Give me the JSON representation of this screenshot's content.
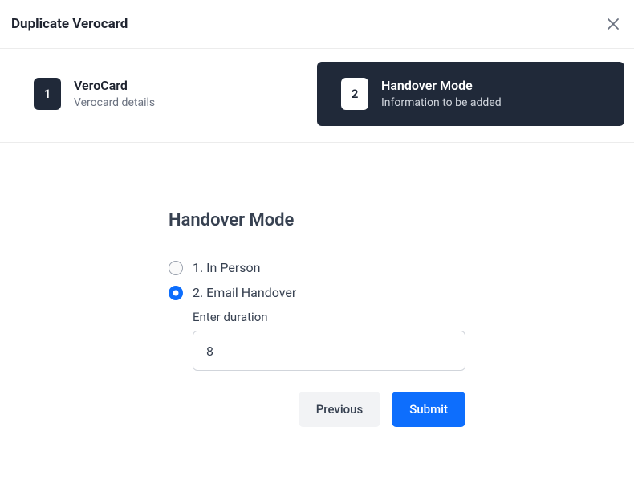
{
  "modal": {
    "title": "Duplicate Verocard"
  },
  "steps": [
    {
      "num": "1",
      "title": "VeroCard",
      "subtitle": "Verocard details"
    },
    {
      "num": "2",
      "title": "Handover Mode",
      "subtitle": "Information to be added"
    }
  ],
  "section": {
    "title": "Handover Mode"
  },
  "options": {
    "in_person": "1. In Person",
    "email_handover": "2. Email Handover",
    "duration_label": "Enter duration",
    "duration_value": "8"
  },
  "actions": {
    "previous": "Previous",
    "submit": "Submit"
  }
}
